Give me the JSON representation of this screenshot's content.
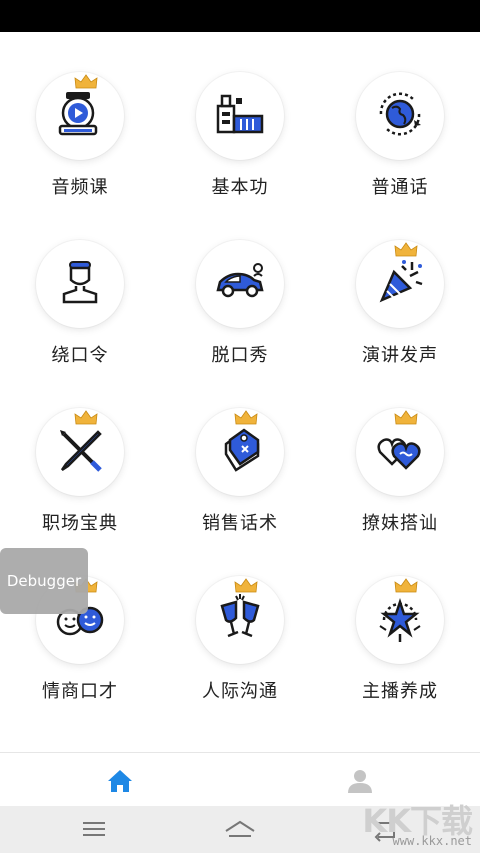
{
  "grid": {
    "items": [
      {
        "label": "音频课",
        "icon": "video-course-icon",
        "premium": true
      },
      {
        "label": "基本功",
        "icon": "factory-icon",
        "premium": false
      },
      {
        "label": "普通话",
        "icon": "globe-icon",
        "premium": false
      },
      {
        "label": "绕口令",
        "icon": "person-icon",
        "premium": false
      },
      {
        "label": "脱口秀",
        "icon": "car-icon",
        "premium": false
      },
      {
        "label": "演讲发声",
        "icon": "party-popper-icon",
        "premium": true
      },
      {
        "label": "职场宝典",
        "icon": "pen-tools-icon",
        "premium": true
      },
      {
        "label": "销售话术",
        "icon": "price-tag-icon",
        "premium": true
      },
      {
        "label": "撩妹搭讪",
        "icon": "hearts-icon",
        "premium": true
      },
      {
        "label": "情商口才",
        "icon": "smiley-faces-icon",
        "premium": true
      },
      {
        "label": "人际沟通",
        "icon": "toast-glasses-icon",
        "premium": true
      },
      {
        "label": "主播养成",
        "icon": "star-badge-icon",
        "premium": true
      }
    ]
  },
  "debugger": {
    "label": "Debugger"
  },
  "tabbar": {
    "tabs": [
      {
        "icon": "home-icon",
        "active": true
      },
      {
        "icon": "user-icon",
        "active": false
      }
    ]
  },
  "colors": {
    "accent": "#2f5bd9",
    "crown": "#f0b33b",
    "tab_active": "#1e88e5",
    "tab_inactive": "#c4c4c4"
  },
  "watermark": {
    "big": "KK下载",
    "small": "www.kkx.net"
  }
}
